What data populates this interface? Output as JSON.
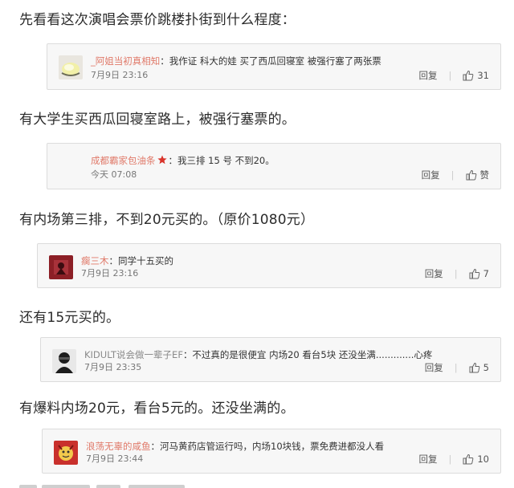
{
  "paragraphs": [
    "先看看这次演唱会票价跳楼扑街到什么程度：",
    "有大学生买西瓜回寝室路上，被强行塞票的。",
    "有内场第三排，不到20元买的。（原价1080元）",
    "还有15元买的。",
    "有爆料内场20元，看台5元的。还没坐满的。"
  ],
  "comments": [
    {
      "username": "_阿姐当初真相知",
      "text": "：我作证 科大的娃 买了西瓜回寝室 被强行塞了两张票",
      "time": "7月9日 23:16",
      "reply": "回复",
      "likes": "31"
    },
    {
      "username": "成都霸家包油条",
      "text": "：我三排 15 号 不到20。",
      "time": "今天 07:08",
      "reply": "回复",
      "likes": "赞"
    },
    {
      "username": "瘸三木",
      "text": "：同学十五买的",
      "time": "7月9日 23:16",
      "reply": "回复",
      "likes": "7"
    },
    {
      "username": "KIDULT说会做一辈子EF",
      "text": "：不过真的是很便宜 内场20 看台5块            还没坐满.............心疼",
      "time": "7月9日 23:35",
      "reply": "回复",
      "likes": "5"
    },
    {
      "username": "浪荡无辜的咸鱼",
      "text": "：河马黄药店管运行吗，内场10块钱，票免费进都没人看",
      "time": "7月9日 23:44",
      "reply": "回复",
      "likes": "10"
    }
  ],
  "icons": {
    "thumb": "thumbs-up-icon",
    "star": "star-icon"
  },
  "colors": {
    "username": "#e07a6a",
    "star": "#d9342b",
    "card_bg": "#f7f7f7"
  }
}
